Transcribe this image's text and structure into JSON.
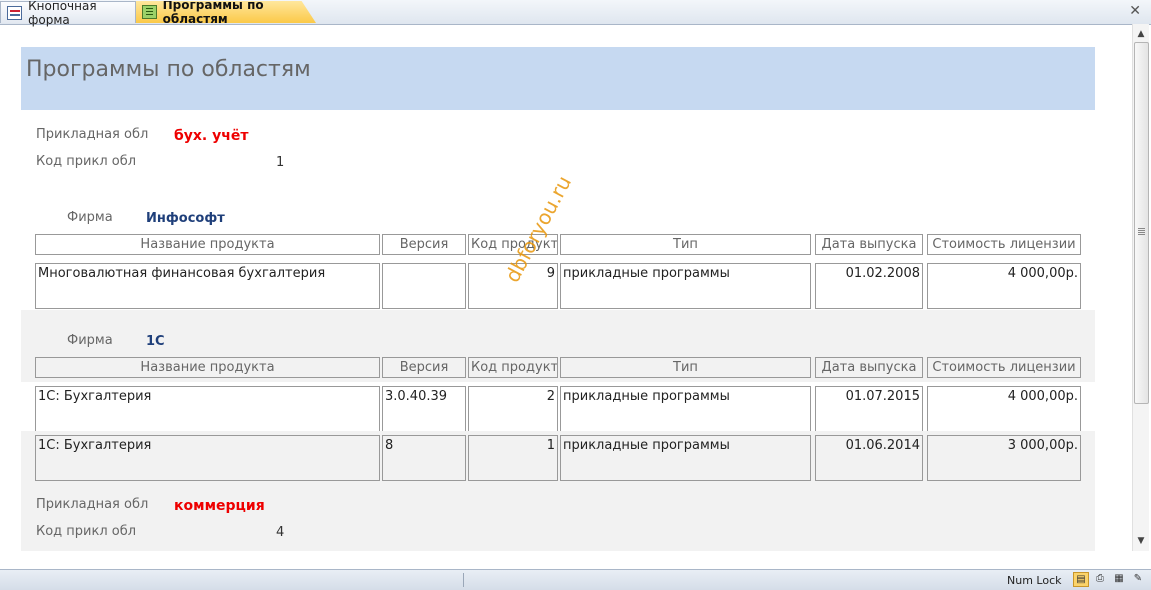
{
  "tabs": [
    {
      "label": "Кнопочная форма",
      "icon": "form-icon"
    },
    {
      "label": "Программы по областям",
      "icon": "report-icon",
      "active": true
    }
  ],
  "report": {
    "title": "Программы по областям",
    "groups": [
      {
        "area_label": "Прикладная обл",
        "area_value": "бух. учёт",
        "code_label": "Код прикл обл",
        "code_value": "1",
        "firms": [
          {
            "firm_label": "Фирма",
            "firm_value": "Инфософт",
            "headers": [
              "Название продукта",
              "Версия",
              "Код продукта",
              "Тип",
              "Дата выпуска",
              "Стоимость лицензии"
            ],
            "rows": [
              [
                "Многовалютная финансовая бухгалтерия",
                "",
                "9",
                "прикладные программы",
                "01.02.2008",
                "4 000,00р."
              ]
            ]
          },
          {
            "firm_label": "Фирма",
            "firm_value": "1С",
            "headers": [
              "Название продукта",
              "Версия",
              "Код продукта",
              "Тип",
              "Дата выпуска",
              "Стоимость лицензии"
            ],
            "rows": [
              [
                "1С: Бухгалтерия",
                "3.0.40.39",
                "2",
                "прикладные программы",
                "01.07.2015",
                "4 000,00р."
              ],
              [
                "1С: Бухгалтерия",
                "8",
                "1",
                "прикладные программы",
                "01.06.2014",
                "3 000,00р."
              ]
            ]
          }
        ]
      },
      {
        "area_label": "Прикладная обл",
        "area_value": "коммерция",
        "code_label": "Код прикл обл",
        "code_value": "4"
      }
    ]
  },
  "watermark": "dbforyou.ru",
  "statusbar": {
    "num_lock": "Num Lock",
    "views": [
      "report-view-icon",
      "print-preview-icon",
      "layout-view-icon",
      "design-view-icon"
    ]
  },
  "colors": {
    "header_band": "#c6d9f1",
    "area_value": "#ee0000",
    "firm_value": "#1f3f7a",
    "active_tab": "#fbc948"
  }
}
